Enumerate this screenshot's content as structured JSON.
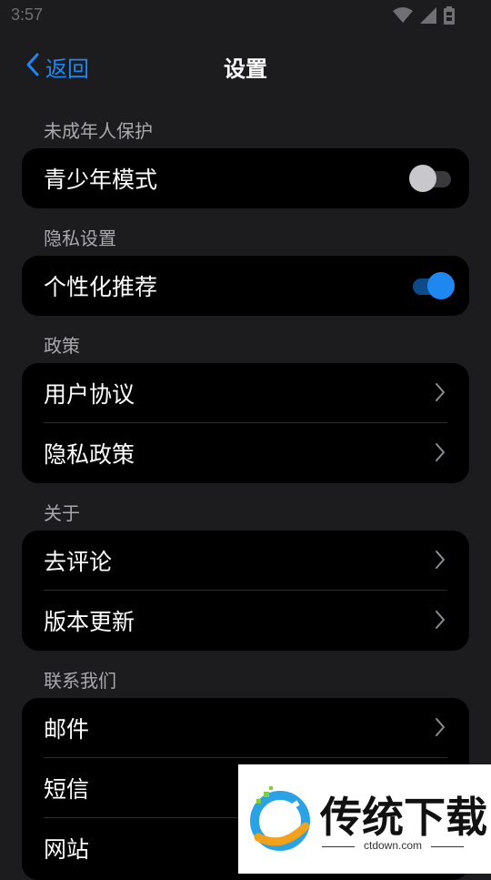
{
  "status_bar": {
    "time": "3:57"
  },
  "nav": {
    "back_label": "返回",
    "title": "设置"
  },
  "sections": [
    {
      "header": "未成年人保护",
      "rows": [
        {
          "label": "青少年模式",
          "control": "toggle",
          "on": false
        }
      ]
    },
    {
      "header": "隐私设置",
      "rows": [
        {
          "label": "个性化推荐",
          "control": "toggle",
          "on": true
        }
      ]
    },
    {
      "header": "政策",
      "rows": [
        {
          "label": "用户协议",
          "control": "chevron"
        },
        {
          "label": "隐私政策",
          "control": "chevron"
        }
      ]
    },
    {
      "header": "关于",
      "rows": [
        {
          "label": "去评论",
          "control": "chevron"
        },
        {
          "label": "版本更新",
          "control": "chevron"
        }
      ]
    },
    {
      "header": "联系我们",
      "rows": [
        {
          "label": "邮件",
          "control": "chevron"
        },
        {
          "label": "短信",
          "control": "chevron"
        },
        {
          "label": "网站",
          "control": "chevron"
        }
      ]
    }
  ],
  "watermark": {
    "title": "传统下载",
    "url": "ctdown.com"
  },
  "colors": {
    "accent": "#1e88f0",
    "background": "#1c1c1e",
    "card": "#000000"
  },
  "icons": [
    "wifi-icon",
    "cellular-signal-icon",
    "battery-icon",
    "back-chevron-icon",
    "chevron-right-icon"
  ]
}
